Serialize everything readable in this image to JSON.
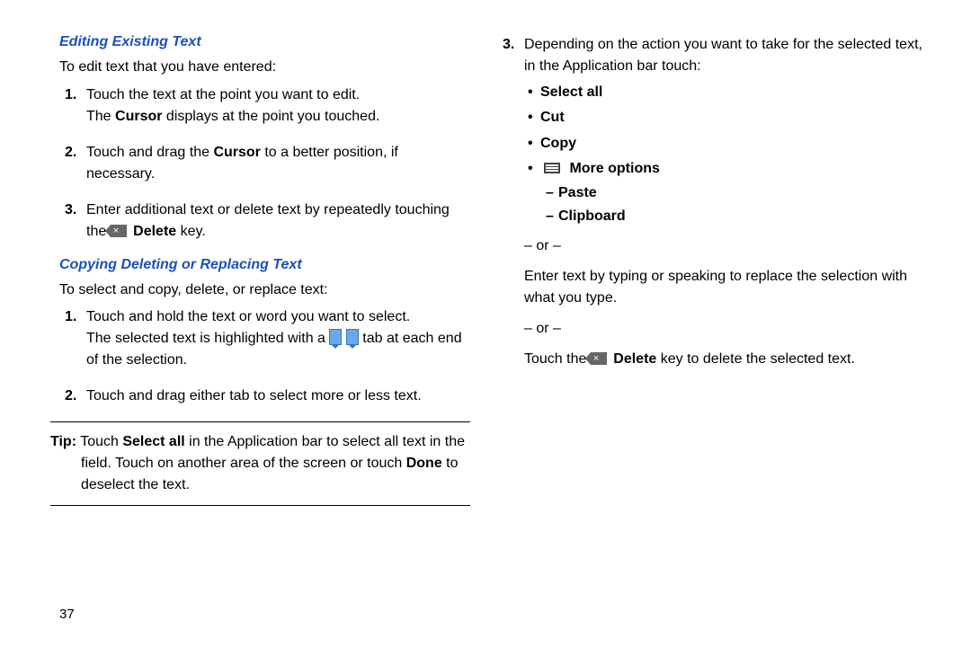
{
  "left": {
    "heading1": "Editing Existing Text",
    "intro1": "To edit text that you have entered:",
    "step1a": "Touch the text at the point you want to edit.",
    "step1b_pre": "The ",
    "step1b_bold": "Cursor",
    "step1b_post": " displays at the point you touched.",
    "step2_pre": "Touch and drag the ",
    "step2_bold": "Cursor",
    "step2_post": " to a better position, if necessary.",
    "step3_pre": "Enter additional text or delete text by repeatedly touching the ",
    "step3_bold": "Delete",
    "step3_post": " key.",
    "heading2": "Copying Deleting or Replacing Text",
    "intro2": "To select and copy, delete, or replace text:",
    "c_step1a": "Touch and hold the text or word you want to select.",
    "c_step1b_pre": "The selected text is highlighted with a ",
    "c_step1b_post": " tab at each end of the selection.",
    "c_step2": "Touch and drag either tab to select more or less text.",
    "tip_label": "Tip:",
    "tip_pre": " Touch ",
    "tip_bold1": "Select all",
    "tip_mid": " in the Application bar to select all text in the field. Touch on another area of the screen or touch ",
    "tip_bold2": "Done",
    "tip_post": " to deselect the text."
  },
  "right": {
    "step3_intro": "Depending on the action you want to take for the selected text, in the Application bar touch:",
    "b1": "Select all",
    "b2": "Cut",
    "b3": "Copy",
    "b4": "More options",
    "d1": "Paste",
    "d2": "Clipboard",
    "or": "– or –",
    "replace": "Enter text by typing or speaking to replace the selection with what you type.",
    "del_pre": "Touch the ",
    "del_bold": "Delete",
    "del_post": " key to delete the selected text."
  },
  "page_number": "37"
}
